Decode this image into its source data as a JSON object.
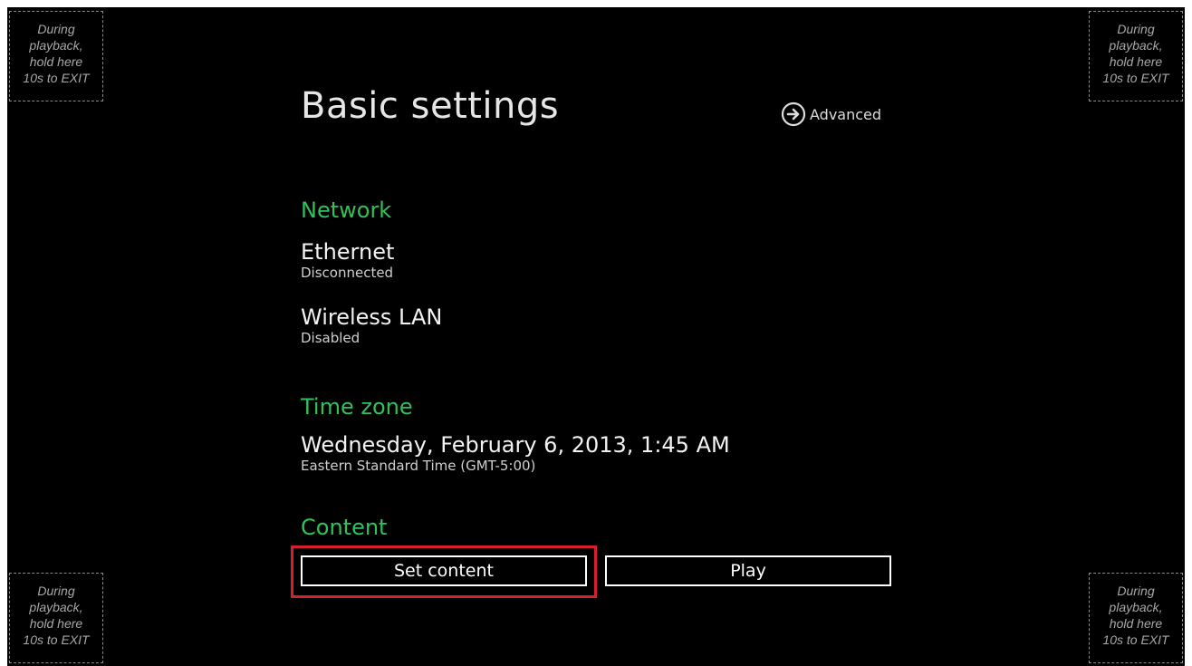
{
  "corners": {
    "lines": [
      "During",
      "playback,",
      "hold here",
      "10s to EXIT"
    ]
  },
  "header": {
    "title": "Basic settings",
    "advanced_label": "Advanced",
    "advanced_icon": "arrow-right-circle-icon"
  },
  "network": {
    "label": "Network",
    "ethernet": {
      "name": "Ethernet",
      "status": "Disconnected"
    },
    "wireless": {
      "name": "Wireless LAN",
      "status": "Disabled"
    }
  },
  "time_zone": {
    "label": "Time zone",
    "datetime": "Wednesday, February 6, 2013, 1:45 AM",
    "zone": "Eastern Standard Time (GMT-5:00)"
  },
  "content": {
    "label": "Content",
    "set_content_label": "Set content",
    "play_label": "Play"
  },
  "colors": {
    "background": "#000000",
    "accent_green": "#2fc25a",
    "highlight_red": "#d7202f",
    "text": "#f2f2f2"
  }
}
